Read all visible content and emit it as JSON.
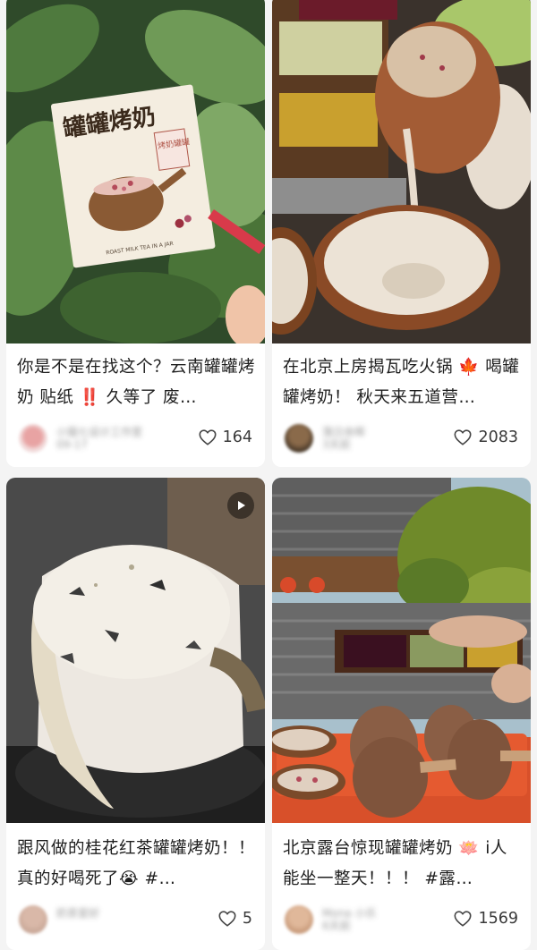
{
  "cards": [
    {
      "title": "你是不是在找这个？云南罐罐烤奶 贴纸 ‼️ 久等了 废…",
      "author": "小猫七设计工作室",
      "author_sub": "09-17",
      "likes": "164",
      "sticker_title": "罐罐烤奶",
      "sticker_badge": "烤奶罐罐",
      "sticker_caption": "ROAST MILK TEA IN A JAR"
    },
    {
      "title": "在北京上房揭瓦吃火锅 🍁 喝罐罐烤奶！ 秋天来五道营…",
      "author": "落日余晖",
      "author_sub": "3天前",
      "likes": "2083"
    },
    {
      "title": "跟风做的桂花红茶罐罐烤奶！！ 真的好喝死了😭 #…",
      "author": "奶茶爱好",
      "author_sub": "",
      "likes": "5",
      "is_video": true
    },
    {
      "title": "北京露台惊现罐罐烤奶 🪷 i人能坐一整天！！！ #露…",
      "author": "Mona 小乐",
      "author_sub": "6天前",
      "likes": "1569"
    }
  ],
  "colors": {
    "background": "#f4f4f4",
    "card": "#ffffff",
    "text": "#1e1e1e",
    "like_text": "#3a3a3a"
  }
}
